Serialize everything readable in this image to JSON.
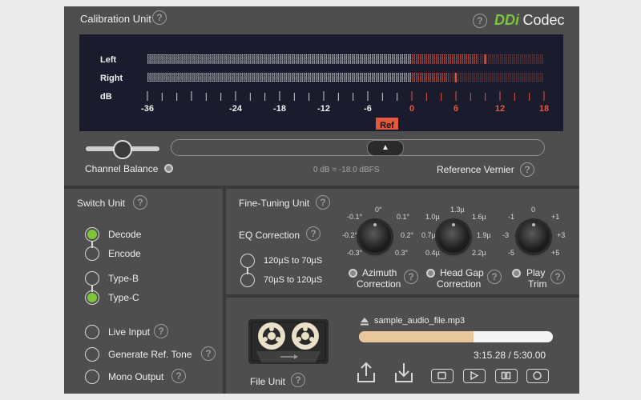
{
  "calibration": {
    "title": "Calibration Unit",
    "brand_prefix": "DDi",
    "brand_name": "Codec",
    "left_label": "Left",
    "right_label": "Right",
    "db_label": "dB",
    "scale_labels": [
      "-36",
      "-24",
      "-18",
      "-12",
      "-6",
      "0",
      "6",
      "12",
      "18"
    ],
    "ref_label": "Ref",
    "channel_balance_label": "Channel Balance",
    "db_info": "0 dB = -18.0 dBFS",
    "reference_vernier_label": "Reference Vernier",
    "balance_level": 0.5,
    "left_level_db": 9,
    "right_level_db": 5,
    "accent_green": "#7cc63a",
    "meter_red": "#e2573f"
  },
  "switch_unit": {
    "title": "Switch Unit",
    "decode_label": "Decode",
    "encode_label": "Encode",
    "typeb_label": "Type-B",
    "typec_label": "Type-C",
    "live_input_label": "Live Input",
    "generate_ref_label": "Generate Ref. Tone",
    "mono_output_label": "Mono Output"
  },
  "fine_tuning": {
    "title": "Fine-Tuning Unit",
    "eq_title": "EQ Correction",
    "eq_opt1": "120µS to 70µS",
    "eq_opt2": "70µS to 120µS",
    "azimuth": {
      "label1": "Azimuth",
      "label2": "Correction",
      "ticks": [
        "-0.1°",
        "0°",
        "0.1°",
        "-0.2°",
        "0.2°",
        "-0.3°",
        "0.3°"
      ]
    },
    "headgap": {
      "label1": "Head Gap",
      "label2": "Correction",
      "ticks": [
        "1.0µ",
        "1.3µ",
        "1.6µ",
        "0.7µ",
        "1.9µ",
        "0.4µ",
        "2.2µ"
      ]
    },
    "playtrim": {
      "label1": "Play",
      "label2": "Trim",
      "ticks": [
        "-1",
        "0",
        "+1",
        "-3",
        "+3",
        "-5",
        "+5"
      ]
    }
  },
  "file_unit": {
    "title": "File Unit",
    "filename": "sample_audio_file.mp3",
    "time": "3:15.28 / 5:30.00",
    "progress": 0.59
  }
}
